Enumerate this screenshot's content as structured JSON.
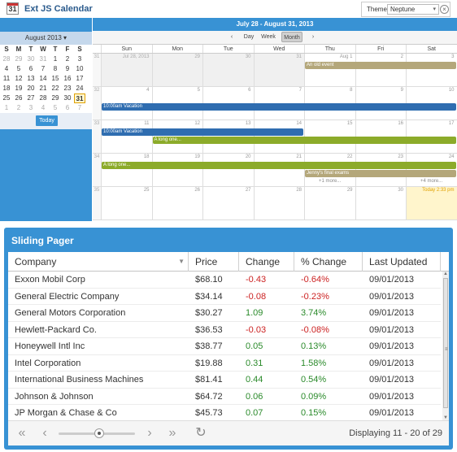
{
  "calendar": {
    "app_title": "Ext JS Calendar",
    "logo_number": "31",
    "theme": {
      "label": "Theme",
      "value": "Neptune"
    },
    "range_title": "July 28 - August 31, 2013",
    "mini": {
      "title": "August 2013 ▾",
      "dow": [
        "S",
        "M",
        "T",
        "W",
        "T",
        "F",
        "S"
      ],
      "weeks": [
        [
          "28",
          "29",
          "30",
          "31",
          "1",
          "2",
          "3"
        ],
        [
          "4",
          "5",
          "6",
          "7",
          "8",
          "9",
          "10"
        ],
        [
          "11",
          "12",
          "13",
          "14",
          "15",
          "16",
          "17"
        ],
        [
          "18",
          "19",
          "20",
          "21",
          "22",
          "23",
          "24"
        ],
        [
          "25",
          "26",
          "27",
          "28",
          "29",
          "30",
          "31"
        ],
        [
          "1",
          "2",
          "3",
          "4",
          "5",
          "6",
          "7"
        ]
      ],
      "today_button": "Today"
    },
    "toolbar": {
      "prev": "‹",
      "day": "Day",
      "week": "Week",
      "month": "Month",
      "next": "›"
    },
    "days_of_week": [
      "Sun",
      "Mon",
      "Tue",
      "Wed",
      "Thu",
      "Fri",
      "Sat"
    ],
    "weeks": [
      {
        "num": "31",
        "days": [
          "Jul 28, 2013",
          "29",
          "30",
          "31",
          "Aug 1",
          "2",
          "3"
        ]
      },
      {
        "num": "32",
        "days": [
          "4",
          "5",
          "6",
          "7",
          "8",
          "9",
          "10"
        ]
      },
      {
        "num": "33",
        "days": [
          "11",
          "12",
          "13",
          "14",
          "15",
          "16",
          "17"
        ]
      },
      {
        "num": "34",
        "days": [
          "18",
          "19",
          "20",
          "21",
          "22",
          "23",
          "24"
        ]
      },
      {
        "num": "35",
        "days": [
          "25",
          "26",
          "27",
          "28",
          "29",
          "30",
          "Today 2:33 pm"
        ]
      }
    ],
    "events": {
      "old_event": "An old event",
      "vacation_1": "10:00am Vacation",
      "vacation_2": "10:00am Vacation",
      "long_one_1": "A long one...",
      "long_one_2": "A long one...",
      "jenny": "Jenny's final exams",
      "more_1": "+1 more...",
      "more_2": "+4 more..."
    }
  },
  "grid": {
    "title": "Sliding Pager",
    "columns": [
      "Company",
      "Price",
      "Change",
      "% Change",
      "Last Updated"
    ],
    "rows": [
      [
        "Exxon Mobil Corp",
        "$68.10",
        "-0.43",
        "-0.64%",
        "09/01/2013"
      ],
      [
        "General Electric Company",
        "$34.14",
        "-0.08",
        "-0.23%",
        "09/01/2013"
      ],
      [
        "General Motors Corporation",
        "$30.27",
        "1.09",
        "3.74%",
        "09/01/2013"
      ],
      [
        "Hewlett-Packard Co.",
        "$36.53",
        "-0.03",
        "-0.08%",
        "09/01/2013"
      ],
      [
        "Honeywell Intl Inc",
        "$38.77",
        "0.05",
        "0.13%",
        "09/01/2013"
      ],
      [
        "Intel Corporation",
        "$19.88",
        "0.31",
        "1.58%",
        "09/01/2013"
      ],
      [
        "International Business Machines",
        "$81.41",
        "0.44",
        "0.54%",
        "09/01/2013"
      ],
      [
        "Johnson & Johnson",
        "$64.72",
        "0.06",
        "0.09%",
        "09/01/2013"
      ],
      [
        "JP Morgan & Chase & Co",
        "$45.73",
        "0.07",
        "0.15%",
        "09/01/2013"
      ]
    ],
    "pager": {
      "first": "«",
      "prev": "‹",
      "next": "›",
      "last": "»",
      "refresh": "↻",
      "display": "Displaying 11 - 20 of 29",
      "slider_position": 0.53
    },
    "colors": {
      "negative": "#cc2222",
      "positive": "#2a8a2a",
      "panel": "#3892d4"
    }
  }
}
